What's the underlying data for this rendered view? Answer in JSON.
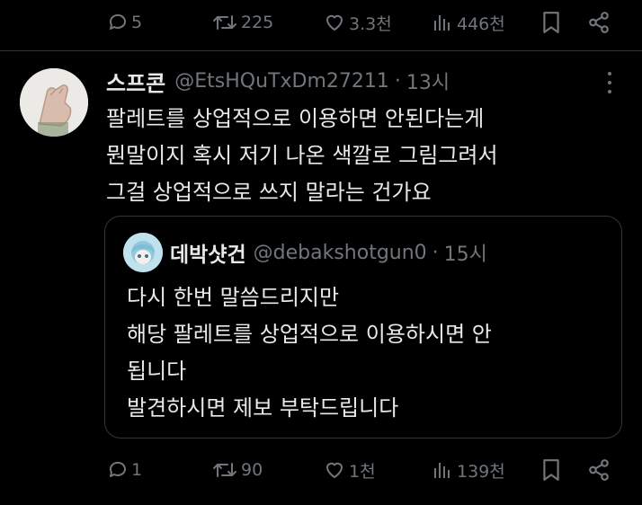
{
  "top_actions": {
    "replies": "5",
    "reposts": "225",
    "likes": "3.3천",
    "views": "446천"
  },
  "tweet": {
    "display_name": "스프콘",
    "handle": "@EtsHQuTxDm27211",
    "separator": "·",
    "time": "13시",
    "lines": [
      "팔레트를 상업적으로 이용하면 안된다는게",
      "뭔말이지 혹시 저기 나온 색깔로 그림그려서",
      "그걸 상업적으로 쓰지 말라는 건가요"
    ]
  },
  "quoted_tweet": {
    "display_name": "데박샷건",
    "handle": "@debakshotgun0",
    "separator": "·",
    "time": "15시",
    "lines": [
      "다시 한번 말씀드리지만",
      "해당 팔레트를 상업적으로 이용하시면 안",
      "됩니다",
      "발견하시면 제보 부탁드립니다"
    ]
  },
  "bottom_actions": {
    "replies": "1",
    "reposts": "90",
    "likes": "1천",
    "views": "139천"
  },
  "colors": {
    "background": "#000000",
    "text": "#e7e9ea",
    "muted": "#71767b",
    "border": "#2f3336"
  }
}
